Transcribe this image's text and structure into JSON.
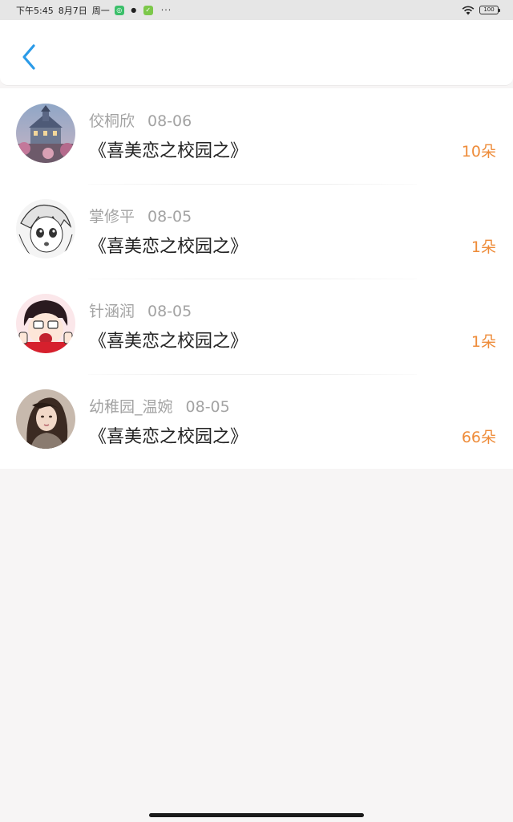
{
  "status_bar": {
    "time": "下午5:45",
    "date": "8月7日",
    "weekday": "周一",
    "more": "···",
    "battery": "100"
  },
  "nav": {
    "back_icon": "chevron-left-icon",
    "accent": "#2b9be8"
  },
  "gifts": [
    {
      "user": "佼桐欣",
      "date": "08-06",
      "title": "《喜美恋之校园之》",
      "amount": "10朵"
    },
    {
      "user": "掌修平",
      "date": "08-05",
      "title": "《喜美恋之校园之》",
      "amount": "1朵"
    },
    {
      "user": "针涵润",
      "date": "08-05",
      "title": "《喜美恋之校园之》",
      "amount": "1朵"
    },
    {
      "user": "幼稚园_温婉",
      "date": "08-05",
      "title": "《喜美恋之校园之》",
      "amount": "66朵"
    }
  ],
  "colors": {
    "amount": "#ee8c3a",
    "meta": "#a3a3a3",
    "title": "#222222"
  }
}
